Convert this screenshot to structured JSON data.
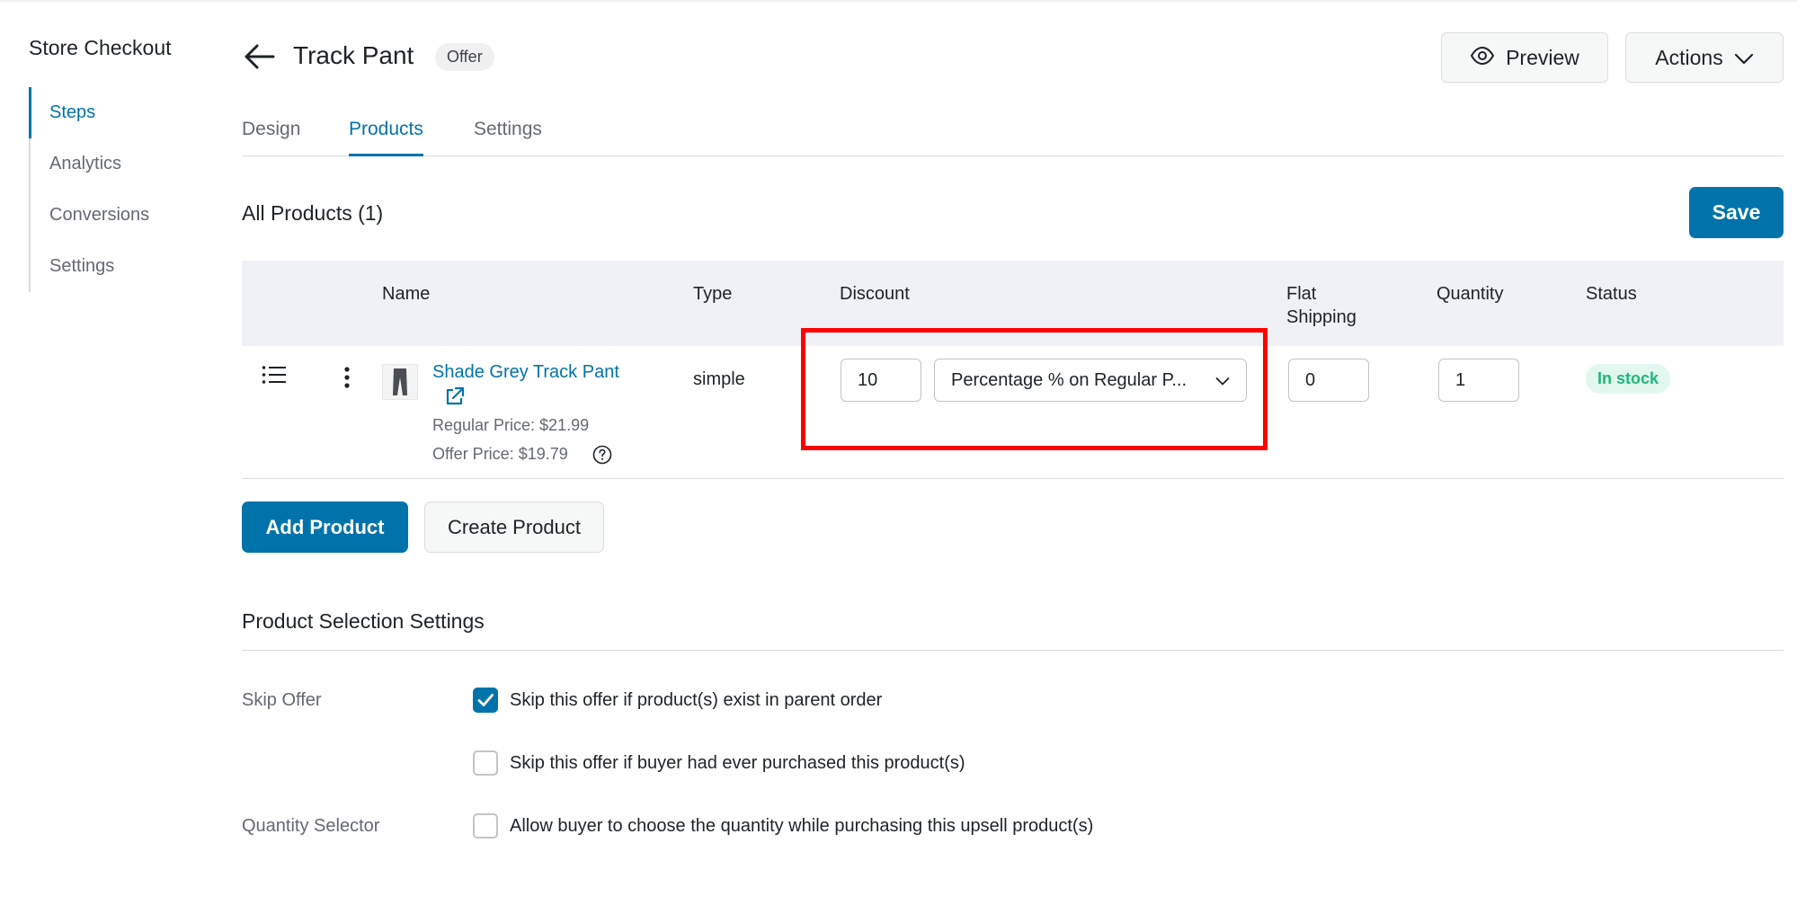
{
  "sidebar": {
    "title": "Store Checkout",
    "items": [
      {
        "label": "Steps"
      },
      {
        "label": "Analytics"
      },
      {
        "label": "Conversions"
      },
      {
        "label": "Settings"
      }
    ]
  },
  "header": {
    "title": "Track Pant",
    "badge": "Offer",
    "preview_label": "Preview",
    "actions_label": "Actions"
  },
  "tabs": [
    {
      "label": "Design"
    },
    {
      "label": "Products"
    },
    {
      "label": "Settings"
    }
  ],
  "products": {
    "title": "All Products (1)",
    "save_label": "Save",
    "columns": {
      "name": "Name",
      "type": "Type",
      "discount": "Discount",
      "flat_shipping": "Flat Shipping",
      "quantity": "Quantity",
      "status": "Status"
    },
    "rows": [
      {
        "name": "Shade Grey Track Pant",
        "regular_price": "Regular Price: $21.99",
        "offer_price": "Offer Price: $19.79",
        "type": "simple",
        "discount_value": "10",
        "discount_type": "Percentage % on Regular P...",
        "flat_shipping": "0",
        "quantity": "1",
        "status": "In stock"
      }
    ],
    "add_product_label": "Add Product",
    "create_product_label": "Create Product"
  },
  "selection_settings": {
    "title": "Product Selection Settings",
    "skip_offer_label": "Skip Offer",
    "quantity_selector_label": "Quantity Selector",
    "options": [
      {
        "label": "Skip this offer if product(s) exist in parent order",
        "checked": true
      },
      {
        "label": "Skip this offer if buyer had ever purchased this product(s)",
        "checked": false
      },
      {
        "label": "Allow buyer to choose the quantity while purchasing this upsell product(s)",
        "checked": false
      }
    ]
  },
  "colors": {
    "accent": "#0073aa",
    "highlight": "#ff0000",
    "stock_green": "#21b67a"
  }
}
